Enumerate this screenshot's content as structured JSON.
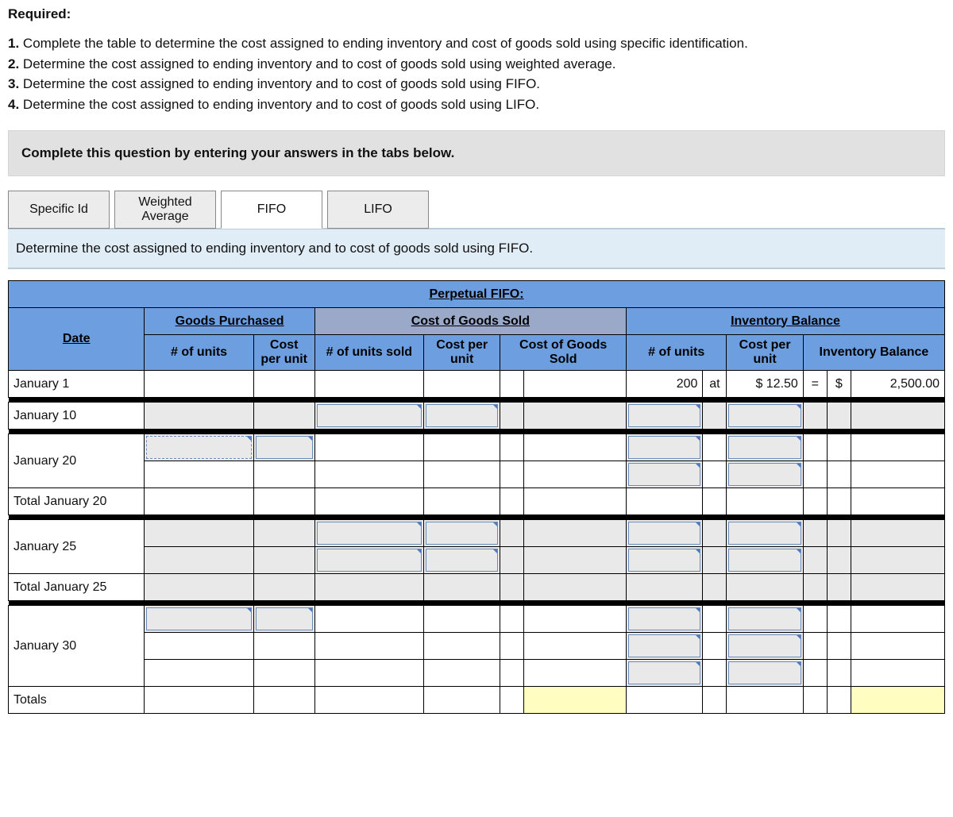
{
  "header": "Required:",
  "requirements": [
    "Complete the table to determine the cost assigned to ending inventory and cost of goods sold using specific identification.",
    "Determine the cost assigned to ending inventory and to cost of goods sold using weighted average.",
    "Determine the cost assigned to ending inventory and to cost of goods sold using FIFO.",
    "Determine the cost assigned to ending inventory and to cost of goods sold using LIFO."
  ],
  "instruction_bar": "Complete this question by entering your answers in the tabs below.",
  "tabs": {
    "specific": "Specific Id",
    "weighted": "Weighted Average",
    "fifo": "FIFO",
    "lifo": "LIFO"
  },
  "tab_description": "Determine the cost assigned to ending inventory and to cost of goods sold using FIFO.",
  "table": {
    "title": "Perpetual FIFO:",
    "section_goods": "Goods Purchased",
    "section_cogs": "Cost of Goods Sold",
    "section_inv": "Inventory Balance",
    "date_hdr": "Date",
    "sub": {
      "units": "# of units",
      "cost_per_unit": "Cost per unit",
      "units_sold": "# of units sold",
      "cogs_total": "Cost of Goods Sold",
      "inv_bal": "Inventory Balance"
    },
    "rows": {
      "r1": "January 1",
      "r2": "January 10",
      "r3": "January 20",
      "r4": "Total January 20",
      "r5": "January 25",
      "r6": "Total January 25",
      "r7": "January 30",
      "r8": "Totals"
    },
    "values": {
      "jan1_units": "200",
      "jan1_at": "at",
      "jan1_cost": "$ 12.50",
      "jan1_eq": "=",
      "jan1_dollar": "$",
      "jan1_bal": "2,500.00"
    }
  }
}
